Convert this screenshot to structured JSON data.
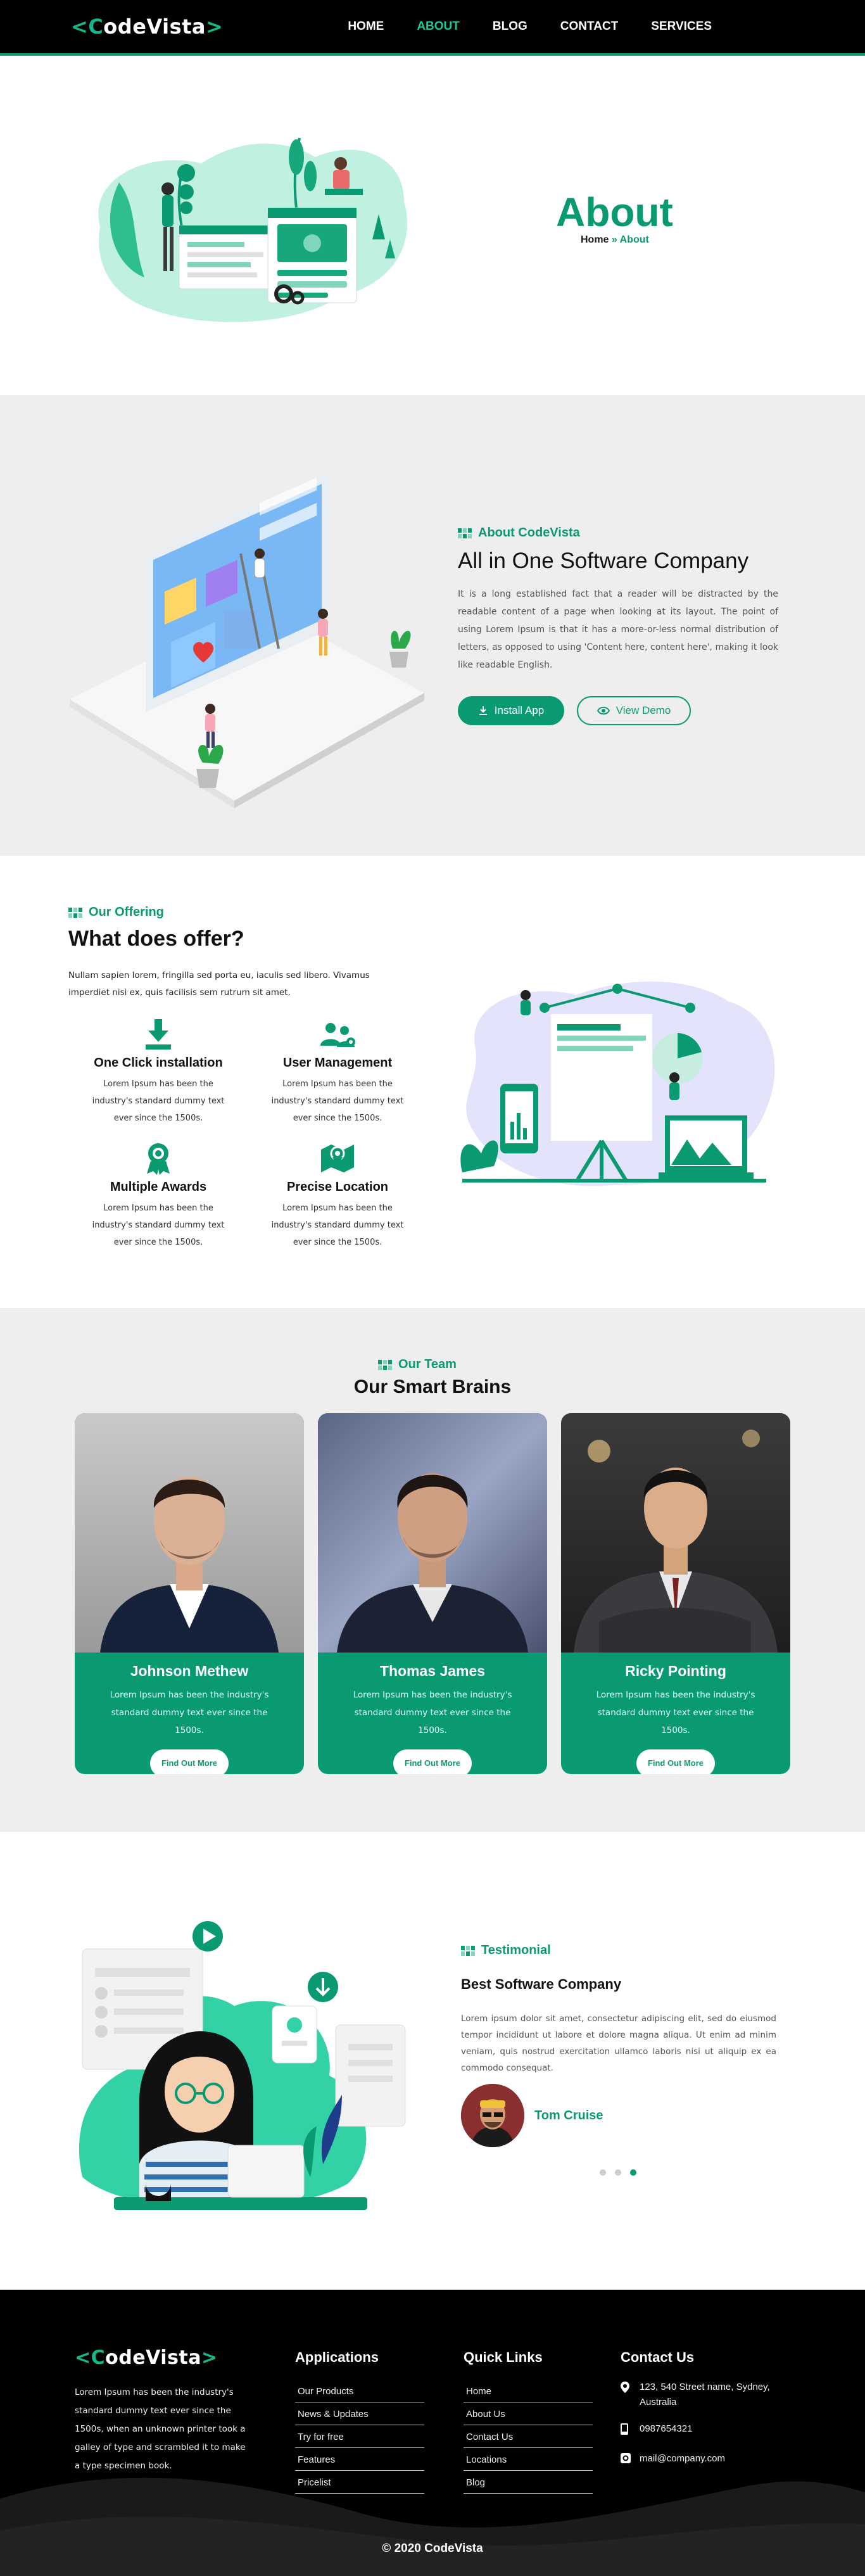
{
  "brand": {
    "name_left": "<",
    "name_c": "C",
    "name_rest": "odeVista",
    "name_right": ">"
  },
  "nav": {
    "items": [
      {
        "label": "HOME"
      },
      {
        "label": "ABOUT"
      },
      {
        "label": "BLOG"
      },
      {
        "label": "CONTACT"
      },
      {
        "label": "SERVICES"
      }
    ]
  },
  "hero": {
    "title": "About",
    "crumb_home": "Home",
    "crumb_sep": " » ",
    "crumb_current": "About"
  },
  "about": {
    "kicker": "About CodeVista",
    "title": "All in One Software Company",
    "text": "It is a long established fact that a reader will be distracted by the readable content of a page when looking at its layout. The point of using Lorem Ipsum is that it has a more-or-less normal distribution of letters, as opposed to using 'Content here, content here', making it look like readable English.",
    "install_label": "Install App",
    "demo_label": "View Demo"
  },
  "offer": {
    "kicker": "Our Offering",
    "title": "What does offer?",
    "lead": "Nullam sapien lorem, fringilla sed porta eu, iaculis sed libero. Vivamus imperdiet nisi ex, quis facilisis sem rutrum sit amet.",
    "features": [
      {
        "title": "One Click installation",
        "text": "Lorem Ipsum has been the industry's standard dummy text ever since the 1500s.",
        "icon": "download-icon"
      },
      {
        "title": "User Management",
        "text": "Lorem Ipsum has been the industry's standard dummy text ever since the 1500s.",
        "icon": "users-icon"
      },
      {
        "title": "Multiple Awards",
        "text": "Lorem Ipsum has been the industry's standard dummy text ever since the 1500s.",
        "icon": "award-icon"
      },
      {
        "title": "Precise Location",
        "text": "Lorem Ipsum has been the industry's standard dummy text ever since the 1500s.",
        "icon": "map-icon"
      }
    ]
  },
  "team": {
    "kicker": "Our Team",
    "title": "Our Smart Brains",
    "members": [
      {
        "name": "Johnson Methew",
        "text": "Lorem Ipsum has been the industry's standard dummy text ever since the 1500s.",
        "button": "Find Out More"
      },
      {
        "name": "Thomas James",
        "text": "Lorem Ipsum has been the industry's standard dummy text ever since the 1500s.",
        "button": "Find Out More"
      },
      {
        "name": "Ricky Pointing",
        "text": "Lorem Ipsum has been the industry's standard dummy text ever since the 1500s.",
        "button": "Find Out More"
      }
    ]
  },
  "testimonial": {
    "kicker": "Testimonial",
    "title": "Best Software Company",
    "text": "Lorem ipsum dolor sit amet, consectetur adipiscing elit, sed do eiusmod tempor incididunt ut labore et dolore magna aliqua. Ut enim ad minim veniam, quis nostrud exercitation ullamco laboris nisi ut aliquip ex ea commodo consequat.",
    "author": "Tom Cruise"
  },
  "footer": {
    "about": "Lorem Ipsum has been the industry's standard dummy text ever since the 1500s, when an unknown printer took a galley of type and scrambled it to make a type specimen book.",
    "applications": {
      "title": "Applications",
      "links": [
        "Our Products",
        "News & Updates",
        "Try for free",
        "Features",
        "Pricelist"
      ]
    },
    "quick": {
      "title": "Quick Links",
      "links": [
        "Home",
        "About Us",
        "Contact Us",
        "Locations",
        "Blog"
      ]
    },
    "contact": {
      "title": "Contact Us",
      "address": "123, 540 Street name, Sydney, Australia",
      "phone": "0987654321",
      "email": "mail@company.com"
    },
    "copyright": "© 2020 CodeVista"
  },
  "colors": {
    "accent": "#0a9a72",
    "dark": "#000000",
    "light_bg": "#eeeeee"
  }
}
